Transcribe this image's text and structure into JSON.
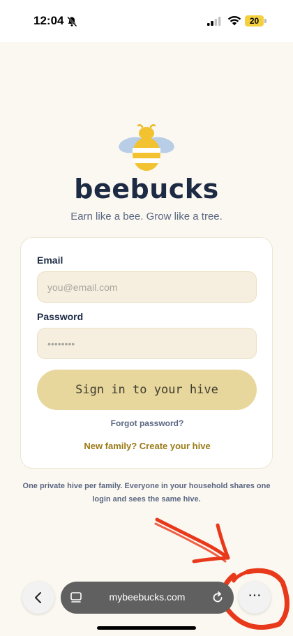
{
  "status_bar": {
    "time": "12:04",
    "battery_level": "20",
    "battery_color": "#f4d03f"
  },
  "brand": {
    "name": "beebucks",
    "tagline": "Earn like a bee. Grow like a tree.",
    "logo_icon": "bee-icon"
  },
  "login_form": {
    "email_label": "Email",
    "email_placeholder": "you@email.com",
    "email_value": "",
    "password_label": "Password",
    "password_placeholder": "••••••••",
    "password_value": "",
    "submit_label": "Sign in to your hive",
    "forgot_label": "Forgot password?",
    "create_label": "New family? Create your hive"
  },
  "footnote": "One private hive per family. Everyone in your household shares one login and sees the same hive.",
  "browser": {
    "url": "mybeebucks.com",
    "more_label": "···"
  },
  "colors": {
    "background": "#fbf8f1",
    "accent": "#e8d79c",
    "link_gold": "#9a7a16",
    "annotation_red": "#e8391b"
  }
}
